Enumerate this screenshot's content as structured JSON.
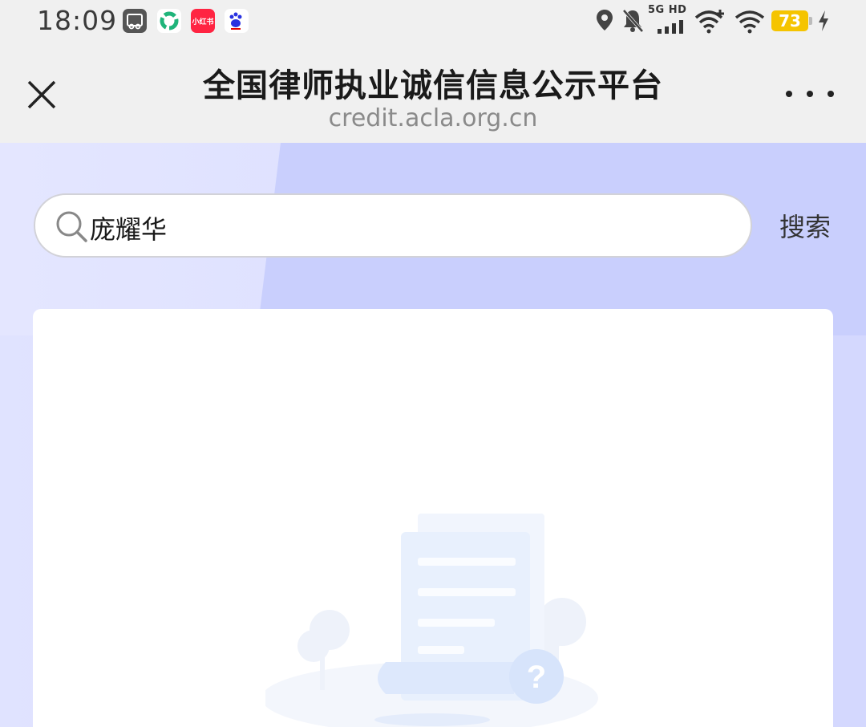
{
  "status_bar": {
    "time": "18:09",
    "network": "5G HD",
    "battery": "73",
    "icons": [
      "video-app-icon",
      "green-app-icon",
      "xiaohongshu-app-icon",
      "baidu-app-icon",
      "location-icon",
      "mute-bell-icon",
      "signal-icon",
      "wifi-plus-icon",
      "wifi-icon",
      "battery-icon",
      "charging-icon"
    ]
  },
  "notifications": {
    "xiaohongshu": "小红书"
  },
  "header": {
    "title": "全国律师执业诚信信息公示平台",
    "url": "credit.acla.org.cn",
    "close_icon": "close-icon",
    "more_icon": "more-icon"
  },
  "search": {
    "value": "庞耀华",
    "button_label": "搜索",
    "icon": "search-icon"
  },
  "colors": {
    "accent_bg": "#c8cdfd",
    "light_bg": "#dfe2ff",
    "battery": "#f5c400"
  }
}
